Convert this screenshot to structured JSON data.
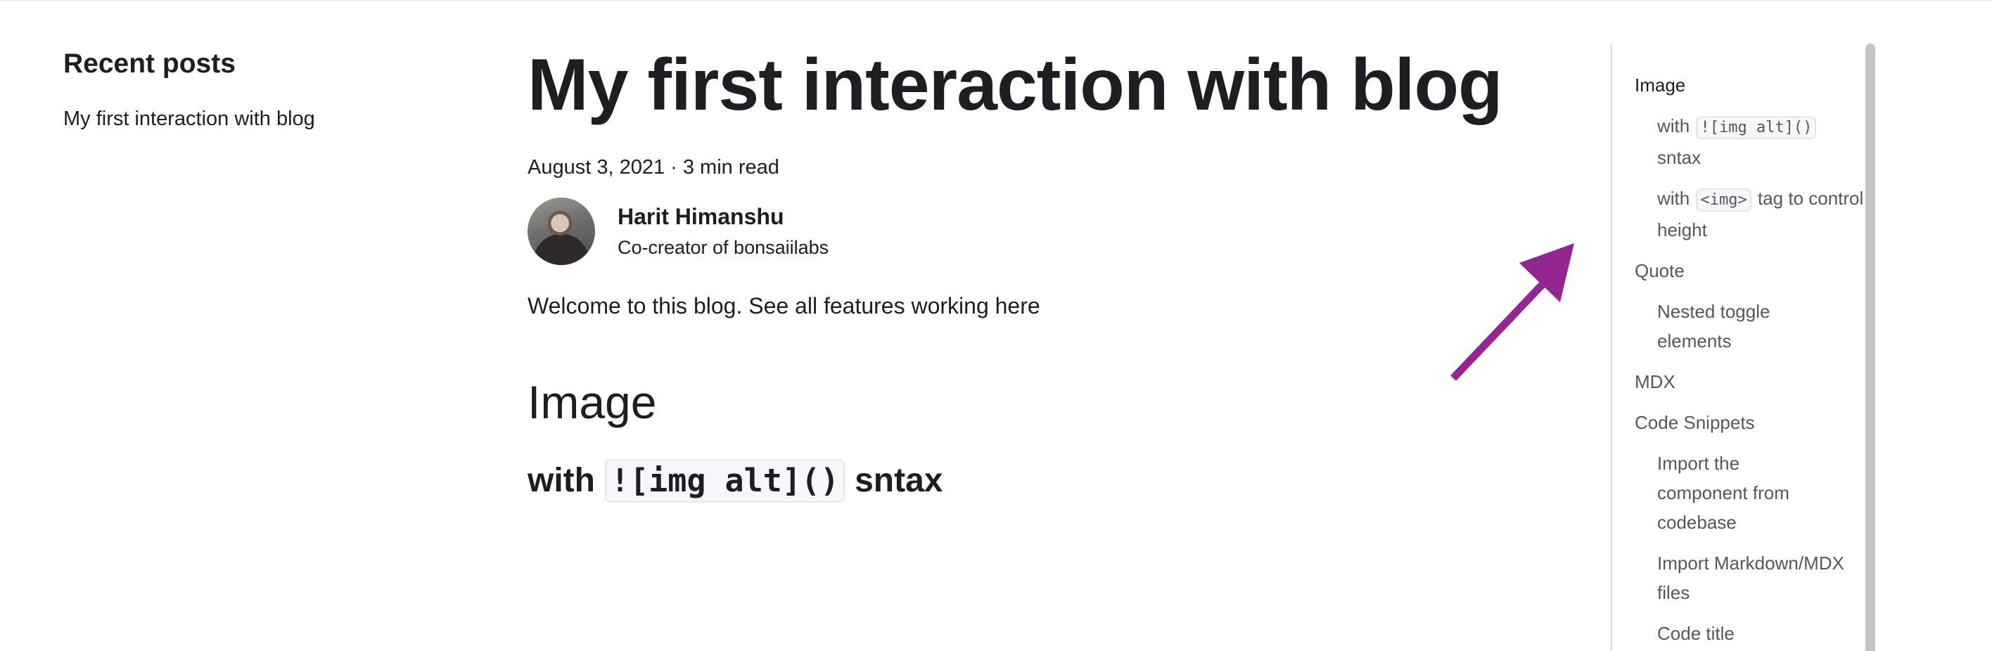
{
  "sidebar": {
    "title": "Recent posts",
    "posts": [
      "My first interaction with blog"
    ]
  },
  "post": {
    "title": "My first interaction with blog",
    "meta": "August 3, 2021 · 3 min read",
    "author": {
      "name": "Harit Himanshu",
      "title": "Co-creator of bonsaiilabs"
    },
    "intro": "Welcome to this blog. See all features working here",
    "section_heading": "Image",
    "subsection": {
      "prefix": "with",
      "code": "![img alt]()",
      "suffix": "sntax"
    }
  },
  "toc": {
    "items": [
      {
        "label": "Image"
      },
      {
        "prefix": "with",
        "code": "![img alt]()",
        "suffix": "sntax"
      },
      {
        "prefix": "with",
        "code": "<img>",
        "suffix": "tag to control height"
      },
      {
        "label": "Quote"
      },
      {
        "label": "Nested toggle elements"
      },
      {
        "label": "MDX"
      },
      {
        "label": "Code Snippets"
      },
      {
        "label": "Import the component from codebase"
      },
      {
        "label": "Import Markdown/MDX files"
      },
      {
        "label": "Code title"
      }
    ]
  },
  "annotation": {
    "arrow_color": "#94278f",
    "arrow_icon": "arrow-up-right-icon"
  }
}
